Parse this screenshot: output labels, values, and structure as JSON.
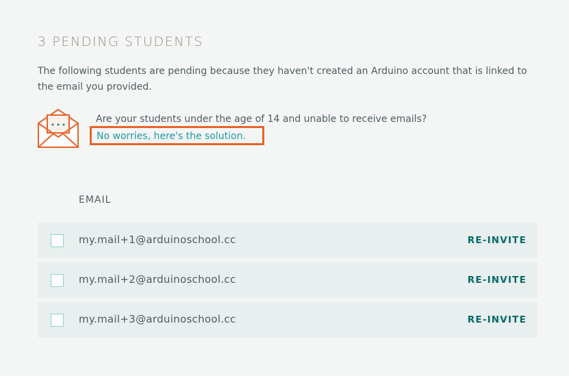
{
  "header": {
    "title": "3 PENDING STUDENTS",
    "description": "The following students are pending because they haven't created an Arduino account that is linked to the email you provided."
  },
  "notice": {
    "icon": "envelope-icon",
    "question": "Are your students under the age of 14 and unable to receive emails?",
    "link_label": "No worries, here's the solution."
  },
  "table": {
    "column_header": "EMAIL",
    "rows": [
      {
        "email": "my.mail+1@arduinoschool.cc",
        "action": "RE-INVITE"
      },
      {
        "email": "my.mail+2@arduinoschool.cc",
        "action": "RE-INVITE"
      },
      {
        "email": "my.mail+3@arduinoschool.cc",
        "action": "RE-INVITE"
      }
    ]
  },
  "colors": {
    "accent_orange": "#e8632b",
    "link_teal": "#1e97a3",
    "action_teal": "#006b6b",
    "title_tan": "#9c8b7e",
    "row_background": "#e9efee",
    "page_background": "#f4f6f5"
  }
}
